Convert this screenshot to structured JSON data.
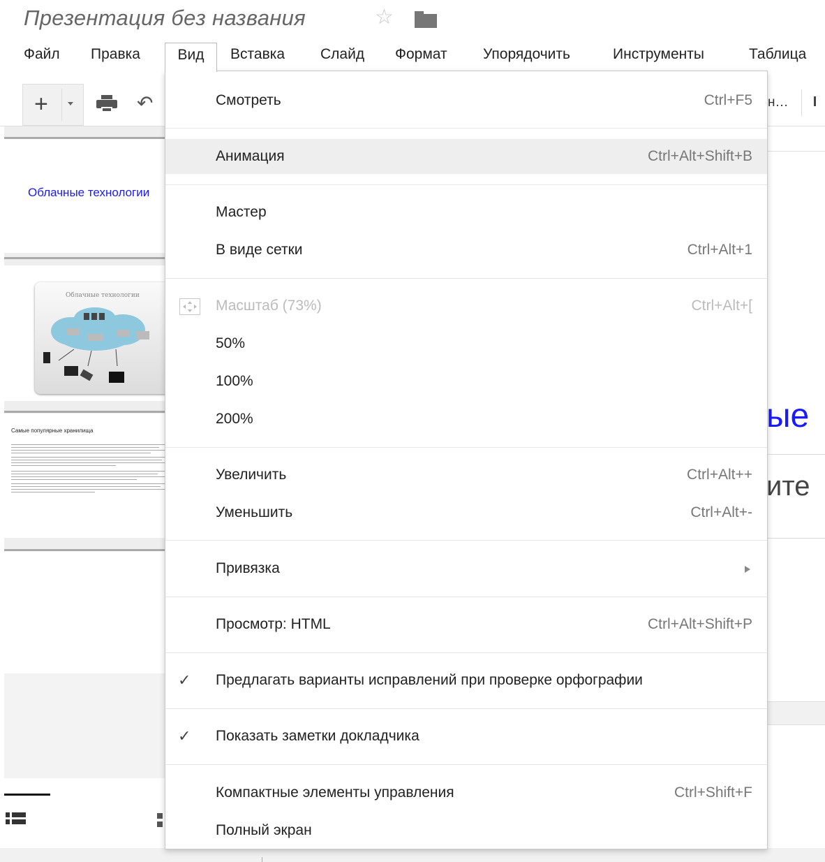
{
  "window": {
    "title": "Презентация без названия",
    "star_icon": "star-icon",
    "folder_icon": "folder-icon"
  },
  "menubar": {
    "items": [
      "Файл",
      "Правка",
      "Вид",
      "Вставка",
      "Слайд",
      "Формат",
      "Упорядочить",
      "Инструменты",
      "Таблица"
    ],
    "open_item": "Вид"
  },
  "toolbar": {
    "add_label": "+",
    "truncated_label": "н…"
  },
  "filmstrip": {
    "slide1_text": "Облачные технологии",
    "slide2_title": "Облачные технологии",
    "slide3_title": "Самые популярные хранилища"
  },
  "background_slide": {
    "title_fragment": "ые",
    "subtitle_fragment": "ите"
  },
  "view_menu": {
    "items": [
      {
        "label": "Смотреть",
        "shortcut": "Ctrl+F5"
      },
      {
        "label": "Анимация",
        "shortcut": "Ctrl+Alt+Shift+B",
        "highlighted": true
      },
      {
        "label": "Мастер",
        "shortcut": ""
      },
      {
        "label": "В виде сетки",
        "shortcut": "Ctrl+Alt+1"
      },
      {
        "label": "Масштаб (73%)",
        "shortcut": "Ctrl+Alt+[",
        "disabled": true,
        "icon": "zoom-fit-icon"
      },
      {
        "label": "50%",
        "shortcut": ""
      },
      {
        "label": "100%",
        "shortcut": ""
      },
      {
        "label": "200%",
        "shortcut": ""
      },
      {
        "label": "Увеличить",
        "shortcut": "Ctrl+Alt++"
      },
      {
        "label": "Уменьшить",
        "shortcut": "Ctrl+Alt+-"
      },
      {
        "label": "Привязка",
        "shortcut": "",
        "submenu": true
      },
      {
        "label": "Просмотр: HTML",
        "shortcut": "Ctrl+Alt+Shift+P"
      },
      {
        "label": "Предлагать варианты исправлений при проверке орфографии",
        "shortcut": "",
        "checked": true
      },
      {
        "label": "Показать заметки докладчика",
        "shortcut": "",
        "checked": true
      },
      {
        "label": "Компактные элементы управления",
        "shortcut": "Ctrl+Shift+F"
      },
      {
        "label": "Полный экран",
        "shortcut": ""
      }
    ],
    "check_glyph": "✓"
  },
  "colors": {
    "accent_link": "#1a1aff",
    "highlight": "#eeeeee"
  }
}
